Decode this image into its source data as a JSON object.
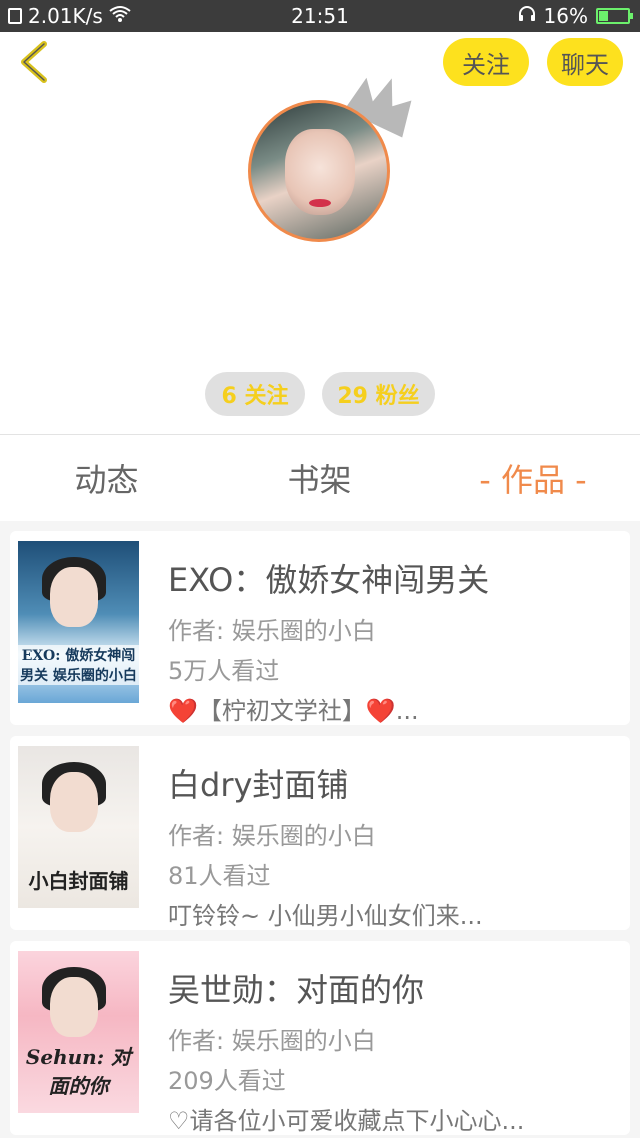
{
  "status_bar": {
    "network_speed": "2.01K/s",
    "time": "21:51",
    "battery": "16%",
    "icons": [
      "sim-icon",
      "wifi-icon",
      "headset-icon",
      "battery-icon"
    ]
  },
  "header": {
    "follow_label": "关注",
    "chat_label": "聊天",
    "following_stat": "6 关注",
    "fans_stat": "29 粉丝",
    "accent_color": "#fde11e",
    "avatar_ring_color": "#f08a4b"
  },
  "tabs": [
    {
      "label": "动态",
      "active": false
    },
    {
      "label": "书架",
      "active": false
    },
    {
      "label": "- 作品 -",
      "active": true
    }
  ],
  "works": [
    {
      "title": "EXO：傲娇女神闯男关",
      "author": "作者: 娱乐圈的小白",
      "views": "5万人看过",
      "desc": "❤️【柠初文学社】❤️...",
      "cover_text": "EXO: 傲娇女神闯男关 娱乐圈的小白"
    },
    {
      "title": "白dry封面铺",
      "author": "作者: 娱乐圈的小白",
      "views": "81人看过",
      "desc": "叮铃铃~ 小仙男小仙女们来...",
      "cover_text": "小白封面铺"
    },
    {
      "title": "吴世勋：对面的你",
      "author": "作者: 娱乐圈的小白",
      "views": "209人看过",
      "desc": "♡请各位小可爱收藏点下小心心...",
      "cover_text": "Sehun: 对面的你"
    }
  ]
}
